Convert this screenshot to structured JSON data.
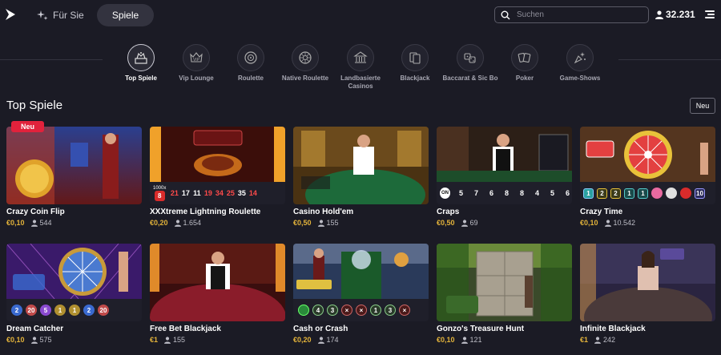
{
  "header": {
    "nav": [
      {
        "label": "Für Sie",
        "icon": "sparkle-icon"
      },
      {
        "label": "Spiele",
        "active": true
      }
    ],
    "search": {
      "placeholder": "Suchen"
    },
    "online_players": "32.231"
  },
  "categories": [
    {
      "label": "Top Spiele",
      "icon": "top-games-icon",
      "active": true
    },
    {
      "label": "Vip Lounge",
      "icon": "vip-icon"
    },
    {
      "label": "Roulette",
      "icon": "roulette-icon"
    },
    {
      "label": "Native Roulette",
      "icon": "native-roulette-icon"
    },
    {
      "label": "Landbasierte Casinos",
      "icon": "casino-building-icon"
    },
    {
      "label": "Blackjack",
      "icon": "blackjack-icon"
    },
    {
      "label": "Baccarat & Sic Bo",
      "icon": "baccarat-icon"
    },
    {
      "label": "Poker",
      "icon": "poker-icon"
    },
    {
      "label": "Game-Shows",
      "icon": "game-shows-icon"
    }
  ],
  "section": {
    "title": "Top Spiele",
    "sort_label": "Neu"
  },
  "games": [
    {
      "name": "Crazy Coin Flip",
      "stake": "€0,10",
      "players": "544",
      "badge": "Neu",
      "results": []
    },
    {
      "name": "XXXtreme Lightning Roulette",
      "stake": "€0,20",
      "players": "1.654",
      "results": [
        "8",
        "21",
        "17",
        "11",
        "19",
        "34",
        "25",
        "35",
        "14"
      ],
      "multiplier": "1000x"
    },
    {
      "name": "Casino Hold'em",
      "stake": "€0,50",
      "players": "155",
      "results": []
    },
    {
      "name": "Craps",
      "stake": "€0,50",
      "players": "69",
      "results": [
        "ON",
        "5",
        "7",
        "6",
        "8",
        "8",
        "4",
        "5",
        "6"
      ]
    },
    {
      "name": "Crazy Time",
      "stake": "€0,10",
      "players": "10.542",
      "results": [
        "1",
        "2",
        "2",
        "1",
        "1",
        "",
        "",
        "10"
      ]
    },
    {
      "name": "Dream Catcher",
      "stake": "€0,10",
      "players": "575",
      "results": [
        "2",
        "20",
        "5",
        "1",
        "1",
        "2",
        "20"
      ]
    },
    {
      "name": "Free Bet Blackjack",
      "stake": "€1",
      "players": "155",
      "results": []
    },
    {
      "name": "Cash or Crash",
      "stake": "€0,20",
      "players": "174",
      "results": [
        "",
        "4",
        "3",
        "×",
        "×",
        "1",
        "3",
        "×"
      ]
    },
    {
      "name": "Gonzo's Treasure Hunt",
      "stake": "€0,10",
      "players": "121",
      "results": []
    },
    {
      "name": "Infinite Blackjack",
      "stake": "€1",
      "players": "242",
      "results": []
    }
  ],
  "colors": {
    "background": "#1b1b25",
    "stake": "#e2b23a",
    "badge_new": "#e1223c",
    "active_tab": "#33333f"
  }
}
